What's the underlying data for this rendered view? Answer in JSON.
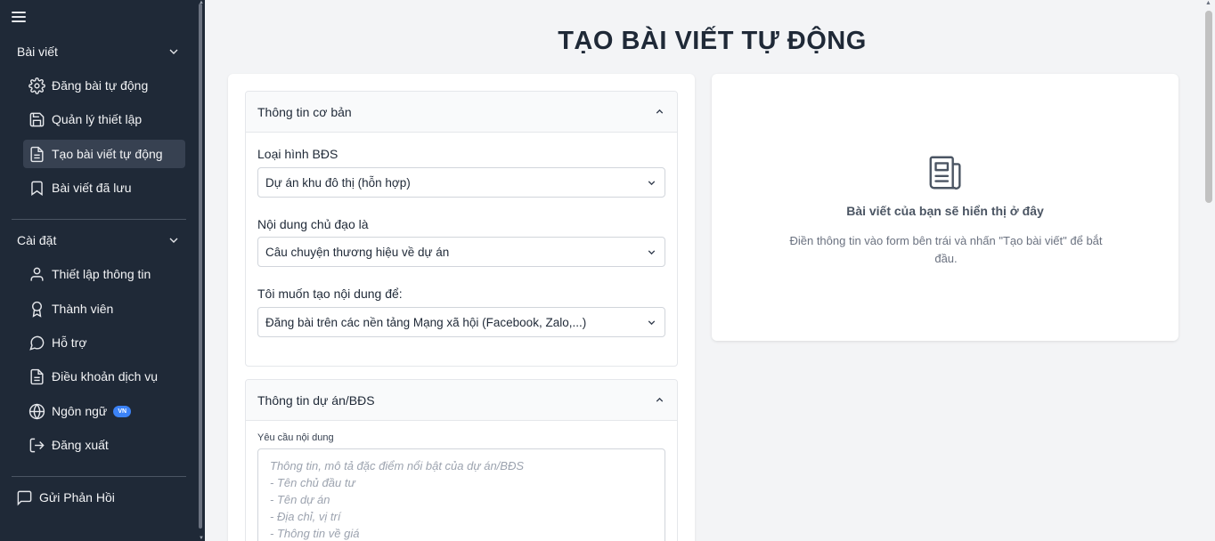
{
  "sidebar": {
    "sections": [
      {
        "title": "Bài viết",
        "items": [
          {
            "label": "Đăng bài tự động",
            "icon": "gear-icon"
          },
          {
            "label": "Quản lý thiết lập",
            "icon": "save-icon"
          },
          {
            "label": "Tạo bài viết tự động",
            "icon": "document-icon",
            "active": true
          },
          {
            "label": "Bài viết đã lưu",
            "icon": "bookmark-icon"
          }
        ]
      },
      {
        "title": "Cài đặt",
        "items": [
          {
            "label": "Thiết lập thông tin",
            "icon": "user-icon"
          },
          {
            "label": "Thành viên",
            "icon": "award-icon"
          },
          {
            "label": "Hỗ trợ",
            "icon": "chat-bubble-icon"
          },
          {
            "label": "Điều khoản dịch vụ",
            "icon": "document-icon"
          },
          {
            "label": "Ngôn ngữ",
            "icon": "globe-icon",
            "badge": "VN"
          },
          {
            "label": "Đăng xuất",
            "icon": "logout-icon"
          }
        ]
      }
    ],
    "feedback_label": "Gửi Phản Hồi"
  },
  "main": {
    "title": "TẠO BÀI VIẾT TỰ ĐỘNG",
    "basic_info": {
      "heading": "Thông tin cơ bản",
      "fields": [
        {
          "label": "Loại hình BĐS",
          "value": "Dự án khu đô thị (hỗn hợp)"
        },
        {
          "label": "Nội dung chủ đạo là",
          "value": "Câu chuyện thương hiệu về dự án"
        },
        {
          "label": "Tôi muốn tạo nội dung để:",
          "value": "Đăng bài trên các nền tảng Mạng xã hội (Facebook, Zalo,...)"
        }
      ]
    },
    "project_info": {
      "heading": "Thông tin dự án/BĐS",
      "content_label": "Yêu cầu nội dung",
      "content_placeholder": "Thông tin, mô tả đặc điểm nổi bật của dự án/BĐS\n- Tên chủ đầu tư\n- Tên dự án\n- Địa chỉ, vị trí\n- Thông tin về giá"
    },
    "preview": {
      "icon": "newspaper-icon",
      "title": "Bài viết của bạn sẽ hiển thị ở đây",
      "description": "Điền thông tin vào form bên trái và nhấn \"Tạo bài viết\" để bắt đầu."
    }
  },
  "colors": {
    "sidebar_bg": "#1f2937",
    "active_item_bg": "#374151",
    "badge_bg": "#3b82f6",
    "page_bg": "#f3f4f6",
    "title_color": "#1f2937"
  }
}
